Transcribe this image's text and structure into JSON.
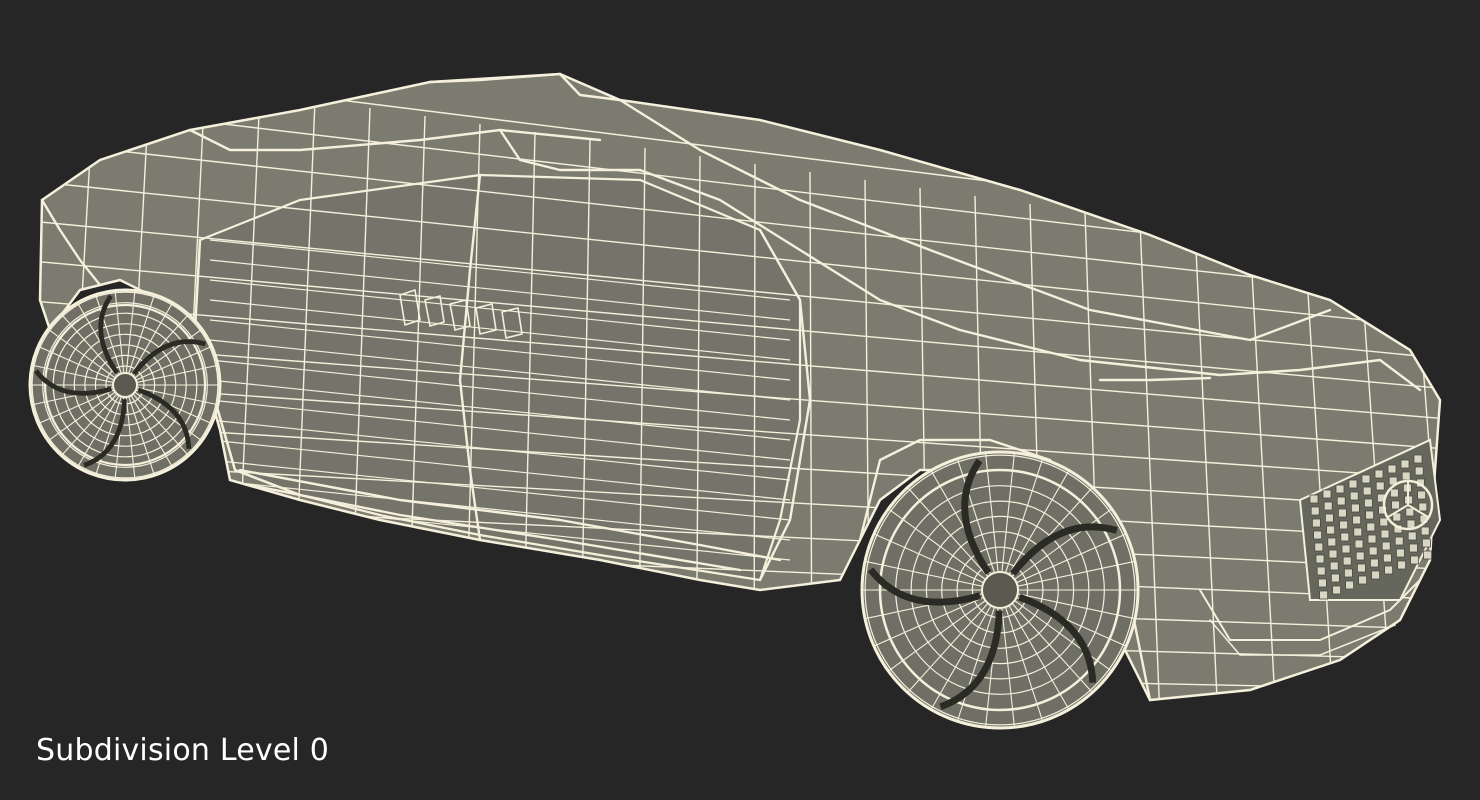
{
  "viewport": {
    "background": "#262626",
    "mesh_fill": "#7b7b6f",
    "mesh_fill_dark": "#5f6055",
    "wire_color": "#f4f0dc"
  },
  "caption": {
    "label": "Subdivision Level 0"
  }
}
